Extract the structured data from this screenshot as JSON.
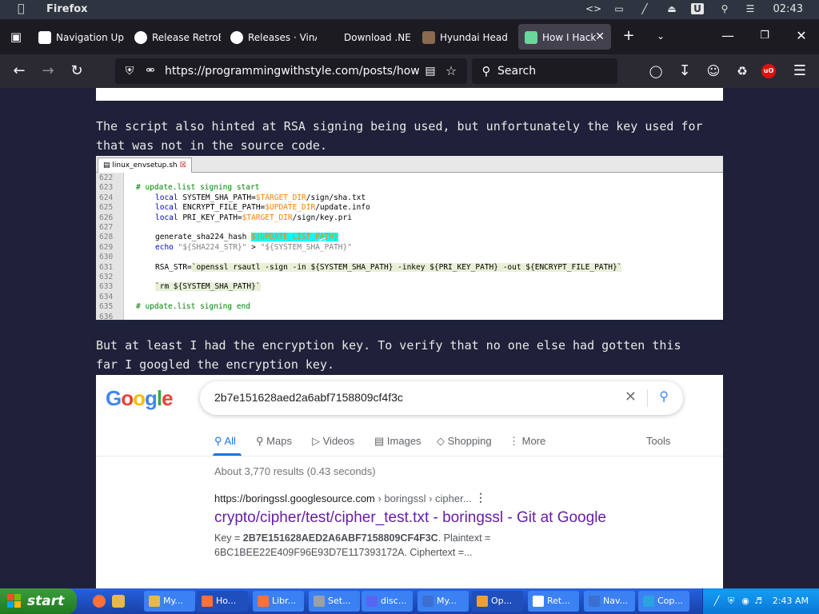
{
  "system_bar": {
    "app_name": "Firefox",
    "clock": "02:43"
  },
  "browser": {
    "tabs": [
      {
        "label": "Navigation Up",
        "active": false
      },
      {
        "label": "Release RetroE",
        "active": false
      },
      {
        "label": "Releases · VinA",
        "active": false
      },
      {
        "label": "Download .NE",
        "active": false
      },
      {
        "label": "Hyundai Head",
        "active": false
      },
      {
        "label": "How I Hack",
        "active": true
      }
    ],
    "url": "https://programmingwithstyle.com/posts/howihack",
    "search_placeholder": "Search"
  },
  "article": {
    "para1_line1": "The script also hinted at RSA signing being used, but unfortunately the key used for",
    "para1_line2": "that was not in the source code.",
    "para2_line1": "But at least I had the encryption key. To verify that no one else had gotten this",
    "para2_line2": "far I googled the encryption key."
  },
  "code_screenshot": {
    "file_tab": "linux_envsetup.sh",
    "lines": [
      {
        "n": "622",
        "parts": []
      },
      {
        "n": "623",
        "parts": [
          {
            "c": "cm",
            "t": "# update.list signing start"
          }
        ],
        "indent": 0
      },
      {
        "n": "624",
        "parts": [
          {
            "c": "kw",
            "t": "local"
          },
          {
            "c": "",
            "t": " SYSTEM_SHA_PATH="
          },
          {
            "c": "vr",
            "t": "$TARGET_DIR"
          },
          {
            "c": "",
            "t": "/sign/sha.txt"
          }
        ],
        "indent": 1
      },
      {
        "n": "625",
        "parts": [
          {
            "c": "kw",
            "t": "local"
          },
          {
            "c": "",
            "t": " ENCRYPT_FILE_PATH="
          },
          {
            "c": "vr",
            "t": "$UPDATE_DIR"
          },
          {
            "c": "",
            "t": "/update.info"
          }
        ],
        "indent": 1
      },
      {
        "n": "626",
        "parts": [
          {
            "c": "kw",
            "t": "local"
          },
          {
            "c": "",
            "t": " PRI_KEY_PATH="
          },
          {
            "c": "vr",
            "t": "$TARGET_DIR"
          },
          {
            "c": "",
            "t": "/sign/key.pri"
          }
        ],
        "indent": 1
      },
      {
        "n": "627",
        "parts": []
      },
      {
        "n": "628",
        "parts": [
          {
            "c": "",
            "t": "generate_sha224_hash "
          },
          {
            "c": "hl",
            "t": "${UPDATE_LIST_PATH}"
          }
        ],
        "indent": 1
      },
      {
        "n": "629",
        "parts": [
          {
            "c": "kw",
            "t": "echo"
          },
          {
            "c": "st",
            "t": " \"${SHA224_STR}\""
          },
          {
            "c": "",
            "t": " > "
          },
          {
            "c": "st",
            "t": "\"${SYSTEM_SHA_PATH}\""
          }
        ],
        "indent": 1
      },
      {
        "n": "630",
        "parts": []
      },
      {
        "n": "631",
        "parts": [
          {
            "c": "",
            "t": "RSA_STR="
          },
          {
            "c": "bt",
            "t": "`openssl rsautl -sign -in ${SYSTEM_SHA_PATH} -inkey ${PRI_KEY_PATH} -out ${ENCRYPT_FILE_PATH}`"
          }
        ],
        "indent": 1
      },
      {
        "n": "632",
        "parts": []
      },
      {
        "n": "633",
        "parts": [
          {
            "c": "bt",
            "t": "`rm ${SYSTEM_SHA_PATH}`"
          }
        ],
        "indent": 1
      },
      {
        "n": "634",
        "parts": []
      },
      {
        "n": "635",
        "parts": [
          {
            "c": "cm",
            "t": "# update.list signing end"
          }
        ],
        "indent": 0
      },
      {
        "n": "636",
        "parts": []
      }
    ]
  },
  "google_screenshot": {
    "logo": "Google",
    "query": "2b7e151628aed2a6abf7158809cf4f3c",
    "tabs": [
      "All",
      "Maps",
      "Videos",
      "Images",
      "Shopping",
      "More"
    ],
    "tools": "Tools",
    "stats": "About 3,770 results (0.43 seconds)",
    "result_site": "https://boringssl.googlesource.com",
    "result_path": " › boringssl › cipher...",
    "result_title": "crypto/cipher/test/cipher_test.txt - boringssl - Git at Google",
    "snippet_pre": "Key = ",
    "snippet_bold": "2B7E151628AED2A6ABF7158809CF4F3C",
    "snippet_post": ". Plaintext =",
    "snippet_line2": "6BC1BEE22E409F96E93D7E117393172A. Ciphertext =..."
  },
  "taskbar": {
    "start_label": "start",
    "items": [
      {
        "label": "My...",
        "color": "#e8b94a"
      },
      {
        "label": "Ho...",
        "color": "#ff7139",
        "active": true
      },
      {
        "label": "Libr...",
        "color": "#ff7139"
      },
      {
        "label": "Set...",
        "color": "#9aa0a6"
      },
      {
        "label": "disc...",
        "color": "#5865f2"
      },
      {
        "label": "My...",
        "color": "#3c6fd1"
      },
      {
        "label": "Op...",
        "color": "#f0a030",
        "active": true
      },
      {
        "label": "Ret...",
        "color": "#ffffff"
      },
      {
        "label": "Nav...",
        "color": "#3c6fd1"
      },
      {
        "label": "Cop...",
        "color": "#2aa3e0"
      }
    ],
    "clock": "2:43 AM"
  }
}
